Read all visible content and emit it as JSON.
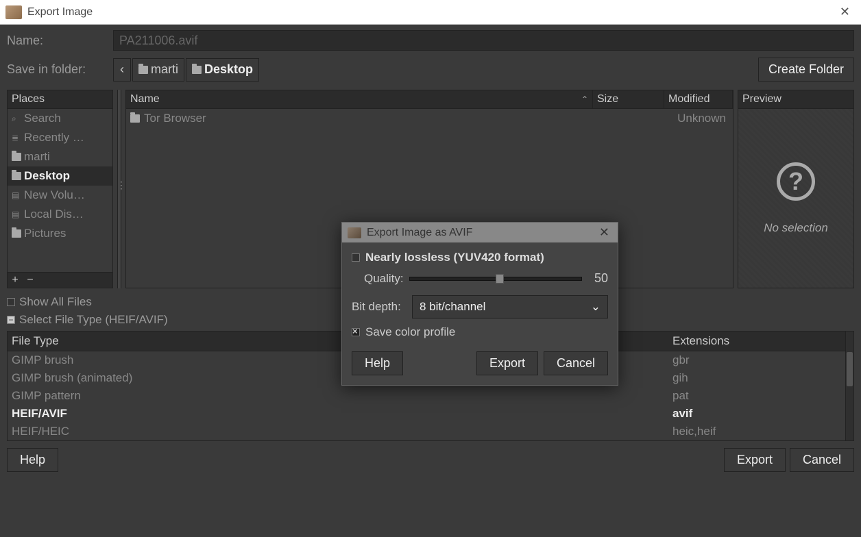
{
  "window": {
    "title": "Export Image"
  },
  "name_row": {
    "label": "Name:",
    "value": "PA211006.avif"
  },
  "folder_row": {
    "label": "Save in folder:",
    "back_glyph": "‹",
    "crumbs": [
      {
        "label": "marti",
        "active": false
      },
      {
        "label": "Desktop",
        "active": true
      }
    ],
    "create_folder": "Create Folder"
  },
  "places": {
    "header": "Places",
    "items": [
      {
        "icon": "🔍",
        "label": "Search"
      },
      {
        "icon": "🕘",
        "label": "Recently …"
      },
      {
        "icon": "folder",
        "label": "marti"
      },
      {
        "icon": "folder",
        "label": "Desktop",
        "selected": true
      },
      {
        "icon": "💾",
        "label": "New Volu…"
      },
      {
        "icon": "💾",
        "label": "Local Dis…"
      },
      {
        "icon": "folder",
        "label": "Pictures"
      }
    ],
    "add": "+",
    "remove": "−"
  },
  "files": {
    "columns": {
      "name": "Name",
      "size": "Size",
      "modified": "Modified"
    },
    "sort_indicator": "⌃",
    "rows": [
      {
        "name": "Tor Browser",
        "size": "",
        "modified": "Unknown"
      }
    ]
  },
  "preview": {
    "header": "Preview",
    "no_selection": "No selection",
    "mark": "?"
  },
  "options": {
    "show_all": "Show All Files",
    "select_type": "Select File Type (HEIF/AVIF)"
  },
  "filetypes": {
    "col1": "File Type",
    "col2": "Extensions",
    "rows": [
      {
        "name": "GIMP brush",
        "ext": "gbr"
      },
      {
        "name": "GIMP brush (animated)",
        "ext": "gih"
      },
      {
        "name": "GIMP pattern",
        "ext": "pat"
      },
      {
        "name": "HEIF/AVIF",
        "ext": "avif",
        "selected": true
      },
      {
        "name": "HEIF/HEIC",
        "ext": "heic,heif"
      }
    ]
  },
  "buttons": {
    "help": "Help",
    "export": "Export",
    "cancel": "Cancel"
  },
  "modal": {
    "title": "Export Image as AVIF",
    "lossless_label": "Nearly lossless (YUV420 format)",
    "quality_label": "Quality:",
    "quality_value": "50",
    "bitdepth_label": "Bit depth:",
    "bitdepth_value": "8 bit/channel",
    "save_profile": "Save color profile",
    "help": "Help",
    "export": "Export",
    "cancel": "Cancel",
    "chevron": "⌄"
  }
}
